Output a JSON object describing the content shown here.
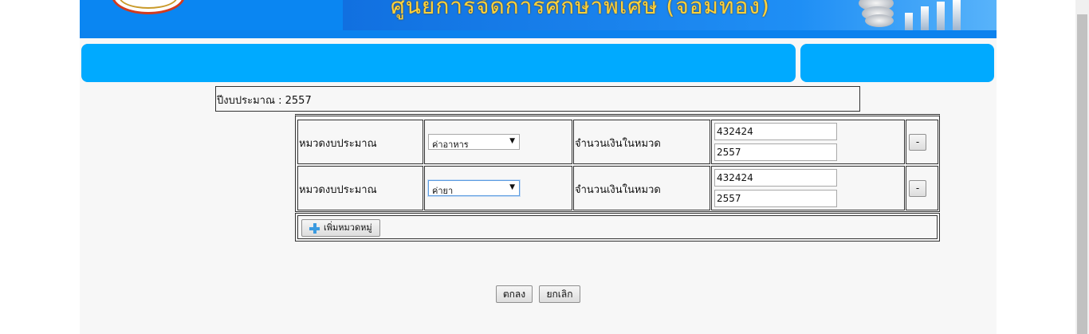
{
  "header": {
    "title": "ศูนย์การจัดการศึกษาพิเศษ (จอมทอง)",
    "accent_color": "#0a86f2",
    "title_color": "#ffd23a",
    "menu_color": "#00aaff"
  },
  "form": {
    "fiscal_year_label": "ปีงบประมาณ : 2557",
    "rows": [
      {
        "category_label": "หมวดงบประมาณ",
        "category_selected": "ค่าอาหาร",
        "amount_label": "จำนวนเงินในหมวด",
        "amount_value": "432424",
        "year_value": "2557",
        "remove_label": "-"
      },
      {
        "category_label": "หมวดงบประมาณ",
        "category_selected": "ค่ายา",
        "amount_label": "จำนวนเงินในหมวด",
        "amount_value": "432424",
        "year_value": "2557",
        "remove_label": "-"
      }
    ],
    "add_category_label": "เพิ่มหมวดหมู่",
    "ok_label": "ตกลง",
    "cancel_label": "ยกเลิก"
  },
  "icons": {
    "add": "plus-icon",
    "dropdown": "chevron-down-icon"
  }
}
